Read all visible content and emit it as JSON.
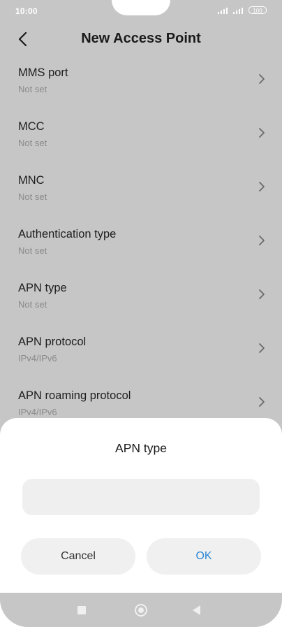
{
  "status_bar": {
    "time": "10:00",
    "battery": "100"
  },
  "header": {
    "title": "New Access Point"
  },
  "list": {
    "items": [
      {
        "title": "MMS port",
        "value": "Not set"
      },
      {
        "title": "MCC",
        "value": "Not set"
      },
      {
        "title": "MNC",
        "value": "Not set"
      },
      {
        "title": "Authentication type",
        "value": "Not set"
      },
      {
        "title": "APN type",
        "value": "Not set"
      },
      {
        "title": "APN protocol",
        "value": "IPv4/IPv6"
      },
      {
        "title": "APN roaming protocol",
        "value": "IPv4/IPv6"
      }
    ]
  },
  "dialog": {
    "title": "APN type",
    "input_value": "",
    "cancel_label": "Cancel",
    "ok_label": "OK"
  },
  "colors": {
    "background_dim": "#c6c6c6",
    "accent": "#2a86d6",
    "dialog_bg": "#ffffff",
    "input_bg": "#efefef"
  },
  "icons": {
    "back": "chevron-left-icon",
    "item_arrow": "chevron-right-icon",
    "nav_recents": "square-icon",
    "nav_home": "circle-icon",
    "nav_back": "triangle-back-icon"
  }
}
